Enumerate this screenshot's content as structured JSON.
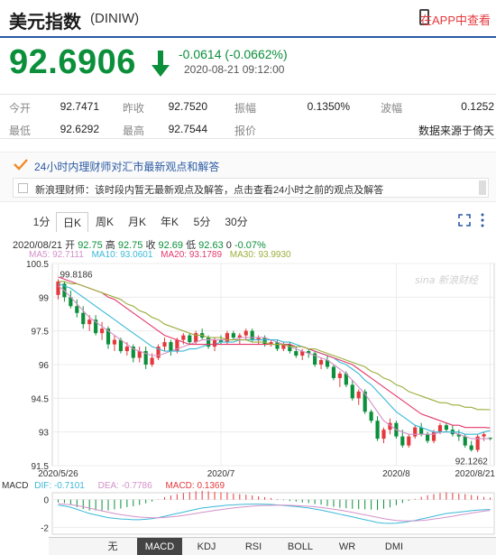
{
  "header": {
    "title": "美元指数",
    "code": "(DINIW)",
    "app_link": "在APP中查看"
  },
  "quote": {
    "price": "92.6906",
    "change": "-0.0614 (-0.0662%)",
    "time": "2020-08-21 09:12:00"
  },
  "stats": [
    {
      "label": "今开",
      "value": "92.7471"
    },
    {
      "label": "昨收",
      "value": "92.7520"
    },
    {
      "label": "振幅",
      "value": "0.1350%"
    },
    {
      "label": "波幅",
      "value": "0.1252"
    },
    {
      "label": "最低",
      "value": "92.6292"
    },
    {
      "label": "最高",
      "value": "92.7544"
    },
    {
      "label": "报价",
      "value": ""
    },
    {
      "label": "",
      "value": "数据来源于倚天"
    }
  ],
  "news": {
    "heading": "24小时内理财师对汇市最新观点和解答",
    "line": "新浪理财师：该时段内暂无最新观点及解答，点击查看24小时之前的观点及解答"
  },
  "tabs": [
    "1分",
    "日K",
    "周K",
    "月K",
    "年K",
    "5分",
    "30分"
  ],
  "active_tab": "日K",
  "kline_info": {
    "date": "2020/08/21",
    "open_label": "开",
    "open": "92.75",
    "high_label": "高",
    "high": "92.75",
    "close_label": "收",
    "close": "92.69",
    "low_label": "低",
    "low": "92.63",
    "vol": "0",
    "pct": "-0.07%"
  },
  "ma_info": {
    "ma5": "MA5: 92.7111",
    "ma10": "MA10: 93.0601",
    "ma20": "MA20: 93.1789",
    "ma30": "MA30: 93.9930"
  },
  "colors": {
    "up": "#e4393c",
    "down": "#0b8f3a",
    "ma5": "#d391c9",
    "ma10": "#3ab9d8",
    "ma20": "#e4396b",
    "ma30": "#9cae3c",
    "accent": "#2b5aa3"
  },
  "chart_data": {
    "type": "line",
    "y_ticks": [
      "100.5",
      "99",
      "97.5",
      "96",
      "94.5",
      "93",
      "91.5"
    ],
    "ylim": [
      91.5,
      100.5
    ],
    "x_labels": [
      "2020/5/26",
      "2020/7",
      "2020/8",
      "2020/8/21"
    ],
    "annotations": [
      "99.8186",
      "92.1262"
    ],
    "watermark": "新浪财经",
    "candles": [
      [
        99.1,
        99.8,
        98.9,
        99.7
      ],
      [
        99.6,
        99.7,
        98.8,
        99.0
      ],
      [
        99.0,
        99.3,
        98.5,
        98.6
      ],
      [
        98.6,
        98.9,
        98.1,
        98.3
      ],
      [
        98.3,
        98.6,
        97.6,
        97.8
      ],
      [
        97.8,
        98.2,
        97.5,
        98.0
      ],
      [
        98.0,
        98.2,
        97.3,
        97.4
      ],
      [
        97.4,
        97.9,
        97.1,
        97.6
      ],
      [
        97.6,
        97.7,
        96.7,
        96.9
      ],
      [
        96.9,
        97.3,
        96.6,
        97.1
      ],
      [
        97.1,
        97.2,
        96.5,
        96.6
      ],
      [
        96.6,
        97.0,
        96.4,
        96.8
      ],
      [
        96.8,
        96.9,
        96.1,
        96.3
      ],
      [
        96.3,
        96.8,
        96.1,
        96.6
      ],
      [
        96.6,
        96.8,
        95.8,
        96.0
      ],
      [
        96.0,
        96.5,
        95.9,
        96.3
      ],
      [
        96.3,
        96.9,
        96.2,
        96.8
      ],
      [
        96.8,
        97.2,
        96.6,
        97.0
      ],
      [
        97.0,
        97.1,
        96.4,
        96.6
      ],
      [
        96.6,
        97.2,
        96.5,
        97.1
      ],
      [
        97.1,
        97.4,
        96.9,
        97.3
      ],
      [
        97.3,
        97.4,
        96.9,
        97.0
      ],
      [
        97.0,
        97.5,
        96.9,
        97.4
      ],
      [
        97.4,
        97.6,
        97.1,
        97.2
      ],
      [
        97.2,
        97.3,
        96.7,
        96.8
      ],
      [
        96.8,
        97.2,
        96.6,
        97.1
      ],
      [
        97.1,
        97.3,
        96.9,
        97.0
      ],
      [
        97.0,
        97.5,
        96.9,
        97.4
      ],
      [
        97.4,
        97.5,
        97.1,
        97.2
      ],
      [
        97.2,
        97.4,
        96.9,
        97.3
      ],
      [
        97.3,
        97.6,
        97.1,
        97.5
      ],
      [
        97.5,
        97.6,
        97.0,
        97.1
      ],
      [
        97.1,
        97.3,
        96.9,
        97.2
      ],
      [
        97.2,
        97.3,
        96.8,
        96.9
      ],
      [
        96.9,
        97.1,
        96.8,
        97.0
      ],
      [
        97.0,
        97.1,
        96.6,
        96.7
      ],
      [
        96.7,
        97.0,
        96.6,
        96.9
      ],
      [
        96.9,
        97.0,
        96.5,
        96.6
      ],
      [
        96.6,
        96.8,
        96.3,
        96.4
      ],
      [
        96.4,
        96.7,
        96.2,
        96.6
      ],
      [
        96.6,
        96.7,
        96.3,
        96.5
      ],
      [
        96.5,
        96.6,
        95.9,
        96.0
      ],
      [
        96.0,
        96.3,
        95.8,
        96.2
      ],
      [
        96.2,
        96.4,
        95.8,
        95.9
      ],
      [
        95.9,
        96.0,
        95.3,
        95.4
      ],
      [
        95.4,
        95.7,
        95.0,
        95.6
      ],
      [
        95.6,
        95.7,
        95.0,
        95.1
      ],
      [
        95.1,
        95.3,
        94.4,
        94.5
      ],
      [
        94.5,
        94.9,
        94.2,
        94.8
      ],
      [
        94.8,
        94.9,
        93.8,
        93.9
      ],
      [
        93.9,
        94.0,
        93.4,
        93.5
      ],
      [
        93.5,
        93.7,
        92.6,
        92.7
      ],
      [
        92.7,
        93.2,
        92.5,
        93.1
      ],
      [
        93.1,
        93.6,
        92.9,
        93.4
      ],
      [
        93.4,
        93.5,
        92.7,
        92.8
      ],
      [
        92.8,
        93.1,
        92.3,
        92.4
      ],
      [
        92.4,
        92.9,
        92.3,
        92.8
      ],
      [
        92.8,
        93.3,
        92.7,
        93.2
      ],
      [
        93.2,
        93.4,
        92.8,
        92.9
      ],
      [
        92.9,
        93.0,
        92.5,
        92.6
      ],
      [
        92.6,
        93.1,
        92.5,
        93.0
      ],
      [
        93.0,
        93.4,
        92.9,
        93.3
      ],
      [
        93.3,
        93.4,
        93.0,
        93.1
      ],
      [
        93.1,
        93.3,
        92.8,
        92.9
      ],
      [
        92.9,
        93.1,
        92.6,
        92.8
      ],
      [
        92.8,
        92.9,
        92.3,
        92.4
      ],
      [
        92.4,
        92.6,
        92.13,
        92.2
      ],
      [
        92.2,
        92.9,
        92.1,
        92.8
      ],
      [
        92.8,
        93.0,
        92.6,
        92.9
      ],
      [
        92.75,
        92.75,
        92.63,
        92.69
      ]
    ],
    "series": [
      {
        "name": "MA5",
        "values": [
          99.5,
          99.3,
          99.0,
          98.7,
          98.4,
          98.1,
          97.9,
          97.7,
          97.5,
          97.3,
          97.1,
          96.9,
          96.7,
          96.6,
          96.5,
          96.4,
          96.4,
          96.5,
          96.6,
          96.7,
          96.8,
          96.9,
          97.0,
          97.1,
          97.1,
          97.1,
          97.1,
          97.1,
          97.1,
          97.2,
          97.2,
          97.2,
          97.2,
          97.2,
          97.1,
          97.0,
          96.9,
          96.8,
          96.7,
          96.6,
          96.5,
          96.4,
          96.3,
          96.2,
          96.0,
          95.8,
          95.6,
          95.3,
          95.0,
          94.7,
          94.3,
          93.9,
          93.5,
          93.3,
          93.1,
          93.0,
          92.9,
          92.9,
          92.9,
          92.9,
          92.9,
          93.0,
          93.0,
          93.0,
          92.9,
          92.8,
          92.7,
          92.7,
          92.7,
          92.71
        ]
      },
      {
        "name": "MA10",
        "values": [
          99.6,
          99.5,
          99.4,
          99.2,
          99.0,
          98.8,
          98.6,
          98.4,
          98.2,
          98.0,
          97.8,
          97.6,
          97.4,
          97.2,
          97.0,
          96.8,
          96.7,
          96.6,
          96.6,
          96.6,
          96.6,
          96.7,
          96.7,
          96.8,
          96.9,
          96.9,
          97.0,
          97.0,
          97.0,
          97.1,
          97.1,
          97.1,
          97.1,
          97.1,
          97.1,
          97.1,
          97.0,
          97.0,
          96.9,
          96.8,
          96.7,
          96.6,
          96.5,
          96.4,
          96.3,
          96.1,
          96.0,
          95.8,
          95.6,
          95.3,
          95.1,
          94.8,
          94.5,
          94.2,
          93.9,
          93.7,
          93.5,
          93.3,
          93.2,
          93.1,
          93.0,
          93.0,
          93.0,
          93.0,
          93.0,
          92.9,
          92.9,
          92.9,
          93.0,
          93.06
        ]
      },
      {
        "name": "MA20",
        "values": [
          99.9,
          99.8,
          99.7,
          99.6,
          99.5,
          99.4,
          99.3,
          99.2,
          99.0,
          98.9,
          98.7,
          98.5,
          98.3,
          98.1,
          97.9,
          97.7,
          97.5,
          97.3,
          97.2,
          97.1,
          97.0,
          96.9,
          96.9,
          96.9,
          96.9,
          96.9,
          96.9,
          96.9,
          96.9,
          96.9,
          96.9,
          96.9,
          96.9,
          96.9,
          96.9,
          96.9,
          96.9,
          96.9,
          96.8,
          96.8,
          96.7,
          96.6,
          96.5,
          96.4,
          96.3,
          96.2,
          96.1,
          96.0,
          95.8,
          95.6,
          95.4,
          95.2,
          95.0,
          94.8,
          94.6,
          94.4,
          94.2,
          94.0,
          93.8,
          93.7,
          93.6,
          93.5,
          93.4,
          93.3,
          93.3,
          93.2,
          93.2,
          93.2,
          93.2,
          93.18
        ]
      },
      {
        "name": "MA30",
        "values": [
          99.7,
          99.7,
          99.6,
          99.6,
          99.5,
          99.4,
          99.3,
          99.2,
          99.1,
          99.0,
          98.9,
          98.7,
          98.6,
          98.4,
          98.3,
          98.1,
          98.0,
          97.8,
          97.7,
          97.6,
          97.5,
          97.4,
          97.3,
          97.3,
          97.2,
          97.2,
          97.2,
          97.1,
          97.1,
          97.1,
          97.1,
          97.0,
          97.0,
          97.0,
          96.9,
          96.9,
          96.9,
          96.8,
          96.8,
          96.8,
          96.7,
          96.7,
          96.6,
          96.5,
          96.4,
          96.3,
          96.2,
          96.1,
          96.0,
          95.9,
          95.7,
          95.6,
          95.4,
          95.3,
          95.1,
          95.0,
          94.8,
          94.7,
          94.6,
          94.5,
          94.4,
          94.3,
          94.3,
          94.2,
          94.2,
          94.1,
          94.1,
          94.0,
          94.0,
          93.99
        ]
      }
    ]
  },
  "macd": {
    "label": "MACD",
    "dif": "DIF: -0.7101",
    "dea": "DEA: -0.7786",
    "macd": "MACD: 0.1369",
    "y_ticks": [
      "0",
      "-2"
    ],
    "ylim": [
      -2.5,
      0.5
    ],
    "dif_values": [
      -0.4,
      -0.45,
      -0.55,
      -0.7,
      -0.85,
      -1.0,
      -1.1,
      -1.2,
      -1.3,
      -1.35,
      -1.4,
      -1.42,
      -1.45,
      -1.45,
      -1.42,
      -1.38,
      -1.3,
      -1.2,
      -1.1,
      -1.0,
      -0.9,
      -0.8,
      -0.7,
      -0.6,
      -0.55,
      -0.5,
      -0.45,
      -0.4,
      -0.38,
      -0.35,
      -0.33,
      -0.32,
      -0.32,
      -0.33,
      -0.35,
      -0.38,
      -0.42,
      -0.46,
      -0.5,
      -0.55,
      -0.6,
      -0.68,
      -0.75,
      -0.85,
      -0.95,
      -1.05,
      -1.15,
      -1.25,
      -1.35,
      -1.45,
      -1.55,
      -1.65,
      -1.7,
      -1.72,
      -1.7,
      -1.65,
      -1.58,
      -1.5,
      -1.4,
      -1.3,
      -1.2,
      -1.1,
      -1.0,
      -0.95,
      -0.9,
      -0.85,
      -0.8,
      -0.76,
      -0.73,
      -0.71
    ],
    "dea_values": [
      -0.3,
      -0.33,
      -0.37,
      -0.43,
      -0.51,
      -0.61,
      -0.71,
      -0.81,
      -0.91,
      -1.0,
      -1.08,
      -1.15,
      -1.21,
      -1.26,
      -1.29,
      -1.31,
      -1.31,
      -1.29,
      -1.25,
      -1.2,
      -1.14,
      -1.07,
      -1.0,
      -0.92,
      -0.85,
      -0.78,
      -0.72,
      -0.66,
      -0.6,
      -0.55,
      -0.51,
      -0.47,
      -0.44,
      -0.42,
      -0.41,
      -0.4,
      -0.4,
      -0.41,
      -0.43,
      -0.45,
      -0.48,
      -0.52,
      -0.57,
      -0.62,
      -0.69,
      -0.76,
      -0.84,
      -0.92,
      -1.01,
      -1.1,
      -1.19,
      -1.28,
      -1.37,
      -1.44,
      -1.5,
      -1.53,
      -1.54,
      -1.53,
      -1.5,
      -1.46,
      -1.4,
      -1.34,
      -1.27,
      -1.2,
      -1.12,
      -1.05,
      -0.97,
      -0.9,
      -0.83,
      -0.78
    ]
  },
  "indicators": [
    "无",
    "MACD",
    "KDJ",
    "RSI",
    "BOLL",
    "WR",
    "DMI"
  ],
  "active_indicator": "MACD"
}
